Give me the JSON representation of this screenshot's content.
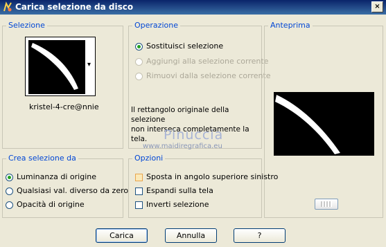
{
  "window": {
    "title": "Carica selezione da disco",
    "close_label": "×"
  },
  "selezione": {
    "label": "Selezione",
    "selection_name": "kristel-4-cre@nnie",
    "dropdown_arrow": "▾"
  },
  "operazione": {
    "label": "Operazione",
    "options": [
      {
        "label": "Sostituisci selezione",
        "checked": true,
        "enabled": true
      },
      {
        "label": "Aggiungi alla selezione corrente",
        "checked": false,
        "enabled": false
      },
      {
        "label": "Rimuovi dalla selezione corrente",
        "checked": false,
        "enabled": false
      }
    ],
    "message": "Il rettangolo originale della selezione\nnon interseca completamente la tela."
  },
  "anteprima": {
    "label": "Anteprima"
  },
  "crea_selezione": {
    "label": "Crea selezione da",
    "options": [
      {
        "label": "Luminanza di origine",
        "checked": true
      },
      {
        "label": "Qualsiasi val. diverso da zero",
        "checked": false
      },
      {
        "label": "Opacità di origine",
        "checked": false
      }
    ]
  },
  "opzioni": {
    "label": "Opzioni",
    "checks": [
      {
        "label": "Sposta in angolo superiore sinistro",
        "checked": false
      },
      {
        "label": "Espandi sulla tela",
        "checked": false
      },
      {
        "label": "Inverti selezione",
        "checked": false
      }
    ]
  },
  "watermark": {
    "title": "Pinuccia",
    "url": "www.maidiregrafica.eu"
  },
  "buttons": {
    "load": "Carica",
    "cancel": "Annulla",
    "help": "?"
  },
  "colors": {
    "title_bar": "#0a246a",
    "group_label": "#0046d5",
    "radio_checked": "#21a121"
  },
  "icons": [
    "app-icon",
    "close-icon",
    "dropdown-arrow-icon",
    "zoom-icon"
  ]
}
